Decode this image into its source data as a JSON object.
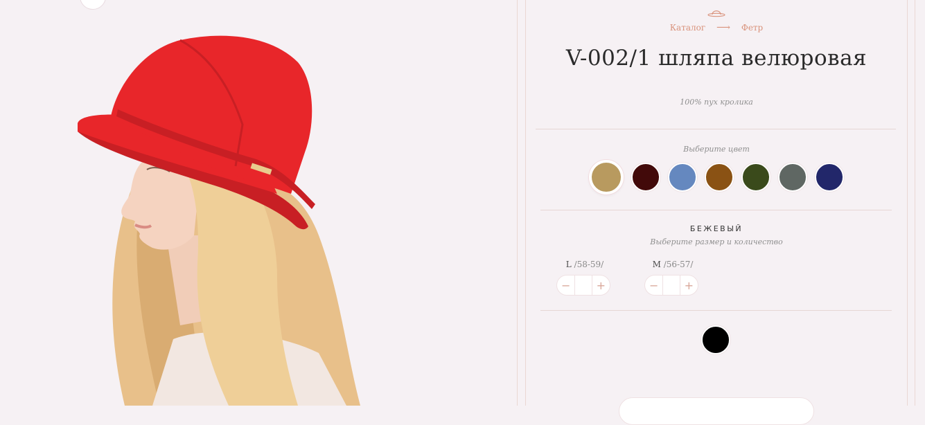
{
  "breadcrumb": {
    "catalog": "Каталог",
    "arrow": "⟶",
    "category": "Фетр"
  },
  "product": {
    "title": "V-002/1 шляпа велюровая",
    "material": "100% пух кролика"
  },
  "colors": {
    "label": "Выберите цвет",
    "swatches": [
      "#b89a5f",
      "#420a0a",
      "#6588bf",
      "#8a5214",
      "#3a4a1b",
      "#5f6763",
      "#22276a"
    ],
    "selected_index": 0,
    "selected_name": "БЕЖЕВЫЙ"
  },
  "sizes": {
    "label": "Выберите размер и количество",
    "items": [
      {
        "size": "L",
        "range": "/58-59/"
      },
      {
        "size": "M",
        "range": "/56-57/"
      }
    ],
    "minus": "−",
    "plus": "+"
  },
  "extra_swatch": {
    "color": "#000000"
  },
  "theme": {
    "background": "#f6f1f4",
    "accent": "#d9927b",
    "hat": "#e8262a"
  }
}
